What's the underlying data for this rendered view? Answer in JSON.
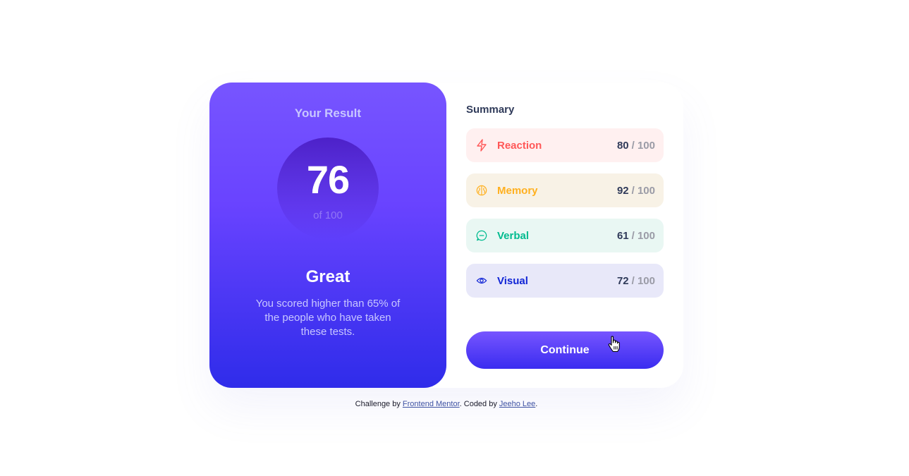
{
  "result": {
    "heading": "Your Result",
    "score": "76",
    "out_of": "of 100",
    "verdict": "Great",
    "description": "You scored higher than 65% of the people who have taken these tests."
  },
  "summary": {
    "title": "Summary",
    "items": [
      {
        "label": "Reaction",
        "score": "80",
        "max": "/ 100",
        "icon": "lightning-icon",
        "color": "#ff5757",
        "bg": "#fff0f0"
      },
      {
        "label": "Memory",
        "score": "92",
        "max": "/ 100",
        "icon": "brain-icon",
        "color": "#ffb01f",
        "bg": "#f8f2e6"
      },
      {
        "label": "Verbal",
        "score": "61",
        "max": "/ 100",
        "icon": "chat-bubble-icon",
        "color": "#00bb8f",
        "bg": "#e9f7f3"
      },
      {
        "label": "Visual",
        "score": "72",
        "max": "/ 100",
        "icon": "eye-icon",
        "color": "#1125d6",
        "bg": "#e8e8f9"
      }
    ],
    "continue_label": "Continue"
  },
  "attribution": {
    "prefix": "Challenge by",
    "link1": "Frontend Mentor",
    "middle": ". Coded by",
    "link2": "Jeeho Lee",
    "suffix": "."
  },
  "colors": {
    "accent_start": "#7755ff",
    "accent_end": "#2f2cea"
  }
}
